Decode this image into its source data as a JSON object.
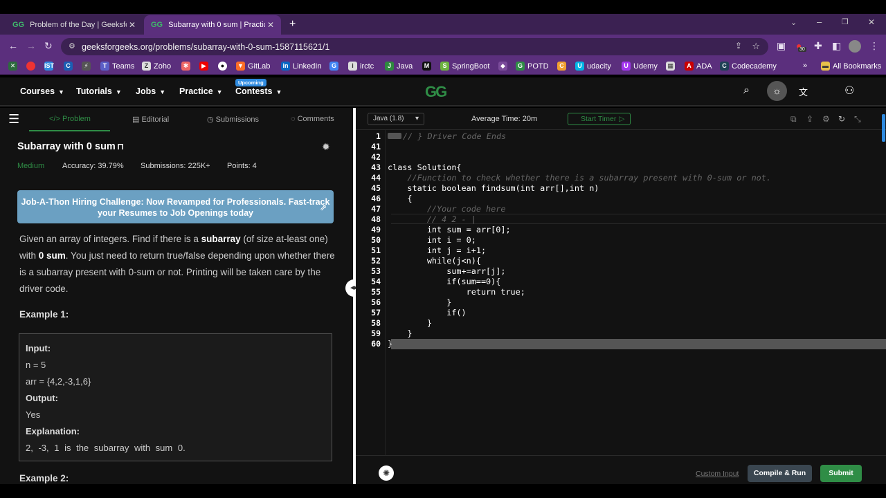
{
  "browser": {
    "tabs": [
      {
        "title": "Problem of the Day | GeeksforGe",
        "active": false
      },
      {
        "title": "Subarray with 0 sum | Practice | G",
        "active": true
      }
    ],
    "new_tab": "+",
    "url": "geeksforgeeks.org/problems/subarray-with-0-sum-1587115621/1",
    "badge_count": "30",
    "bookmarks": [
      "Teams",
      "Zoho",
      "GitLab",
      "LinkedIn",
      "irctc",
      "Java",
      "SpringBoot",
      "POTD",
      "udacity",
      "Udemy",
      "ADA",
      "Codecademy"
    ],
    "all_bookmarks": "All Bookmarks"
  },
  "site": {
    "nav": [
      "Courses",
      "Tutorials",
      "Jobs",
      "Practice",
      "Contests"
    ],
    "upcoming_badge": "Upcoming",
    "logo": "GG"
  },
  "problem_tabs": [
    "Problem",
    "Editorial",
    "Submissions",
    "Comments"
  ],
  "problem": {
    "title": "Subarray with 0 sum",
    "difficulty": "Medium",
    "accuracy": "Accuracy: 39.79%",
    "submissions": "Submissions: 225K+",
    "points": "Points: 4",
    "banner": "Job-A-Thon Hiring Challenge: Now Revamped for Professionals. Fast-track your Resumes to Job Openings today",
    "desc_1": "Given an array of integers. Find if there is a ",
    "desc_b1": "subarray",
    "desc_2": " (of size at-least one) with ",
    "desc_b2": "0 sum",
    "desc_3": ". You just need to return true/false depending upon whether there is a subarray present with 0-sum or not. Printing will be taken care by the driver code.",
    "example1_title": "Example 1:",
    "example1": {
      "input_label": "Input:",
      "n": "n = 5",
      "arr": "arr = {4,2,-3,1,6}",
      "output_label": "Output:",
      "output": "Yes",
      "explanation_label": "Explanation:",
      "explanation": "2, -3, 1 is the subarray with sum 0."
    },
    "example2_title": "Example 2:"
  },
  "editor": {
    "language": "Java (1.8)",
    "average_time": "Average Time: 20m",
    "start_timer": "Start Timer",
    "line_numbers": [
      "1",
      "41",
      "42",
      "43",
      "44",
      "45",
      "46",
      "47",
      "48",
      "49",
      "50",
      "51",
      "52",
      "53",
      "54",
      "55",
      "56",
      "57",
      "58",
      "59",
      "60"
    ],
    "code": [
      "// } Driver Code Ends",
      "",
      "",
      "class Solution{",
      "    //Function to check whether there is a subarray present with 0-sum or not.",
      "    static boolean findsum(int arr[],int n)",
      "    {",
      "        //Your code here",
      "        // 4 2 - |",
      "        int sum = arr[0];",
      "        int i = 0;",
      "        int j = i+1;",
      "        while(j<n){",
      "            sum+=arr[j];",
      "            if(sum==0){",
      "                return true;",
      "            }",
      "            if()",
      "        }",
      "    }",
      "}"
    ],
    "custom_input": "Custom Input",
    "compile_run": "Compile & Run",
    "submit": "Submit"
  },
  "colors": {
    "accent_green": "#2f8d46",
    "browser_purple": "#5b2f7d",
    "banner_blue": "#6ba0c2"
  }
}
